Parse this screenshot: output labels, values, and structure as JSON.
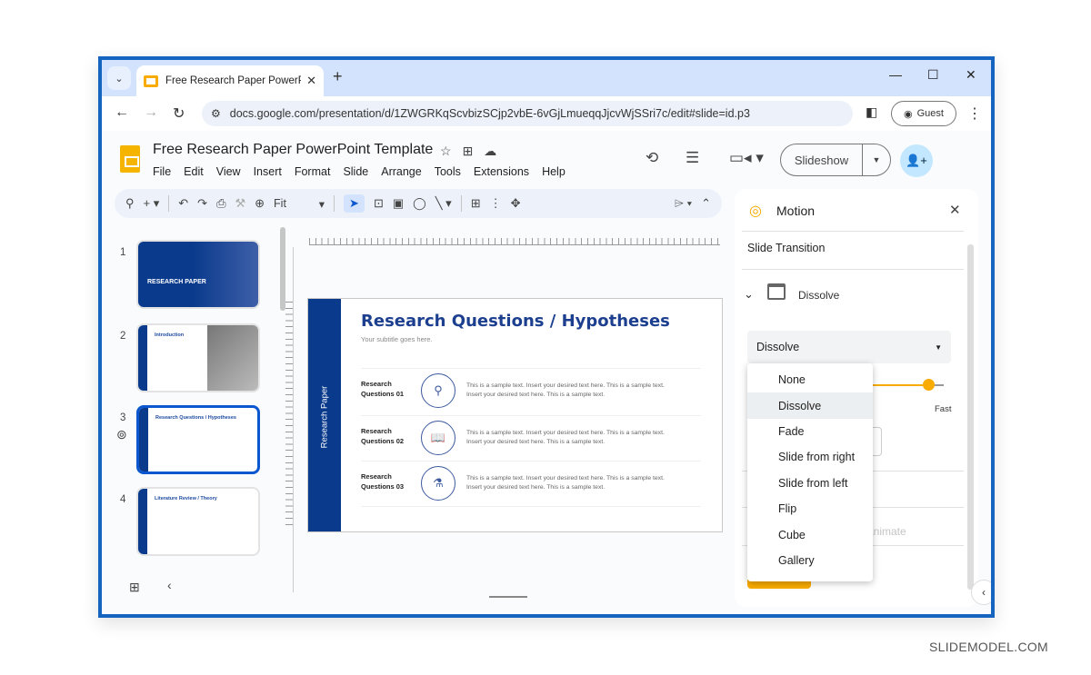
{
  "browser": {
    "tab_title": "Free Research Paper PowerPoint Template",
    "new_tab_icon": "+",
    "url": "docs.google.com/presentation/d/1ZWGRKqScvbizSCjp2vbE-6vGjLmueqqJjcvWjSSri7c/edit#slide=id.p3",
    "profile_label": "Guest"
  },
  "docs": {
    "title": "Free Research Paper PowerPoint Template",
    "menu": [
      "File",
      "Edit",
      "View",
      "Insert",
      "Format",
      "Slide",
      "Arrange",
      "Tools",
      "Extensions",
      "Help"
    ],
    "slideshow_label": "Slideshow"
  },
  "toolbar": {
    "zoom_label": "Fit"
  },
  "filmstrip": {
    "slides": [
      {
        "number": "1",
        "title": "RESEARCH PAPER"
      },
      {
        "number": "2",
        "title": "Introduction"
      },
      {
        "number": "3",
        "title": "Research Questions / Hypotheses"
      },
      {
        "number": "4",
        "title": "Literature Review / Theory"
      }
    ],
    "active_slide": 3
  },
  "slide": {
    "side_label": "Research Paper",
    "title": "Research Questions / Hypotheses",
    "subtitle": "Your subtitle goes here.",
    "rows": [
      {
        "label_line1": "Research",
        "label_line2": "Questions 01",
        "icon": "magnifier-icon",
        "text_line1": "This is a sample text. Insert your desired text here. This is a sample text.",
        "text_line2": "Insert your desired text here. This is a sample text."
      },
      {
        "label_line1": "Research",
        "label_line2": "Questions 02",
        "icon": "book-icon",
        "text_line1": "This is a sample text. Insert your desired text here. This is a sample text.",
        "text_line2": "Insert your desired text here. This is a sample text."
      },
      {
        "label_line1": "Research",
        "label_line2": "Questions 03",
        "icon": "microscope-icon",
        "text_line1": "This is a sample text. Insert your desired text here. This is a sample text.",
        "text_line2": "Insert your desired text here. This is a sample text."
      }
    ]
  },
  "motion_panel": {
    "title": "Motion",
    "section": "Slide Transition",
    "transition_name": "Dissolve",
    "dropdown_value": "Dissolve",
    "speed_label_fast": "Fast",
    "speed_value_fraction": 0.9,
    "animate_label": "animate",
    "accent_color": "#f9ab00"
  },
  "transition_menu": {
    "options": [
      "None",
      "Dissolve",
      "Fade",
      "Slide from right",
      "Slide from left",
      "Flip",
      "Cube",
      "Gallery"
    ],
    "highlighted": "Dissolve"
  },
  "watermark": "SLIDEMODEL.COM"
}
